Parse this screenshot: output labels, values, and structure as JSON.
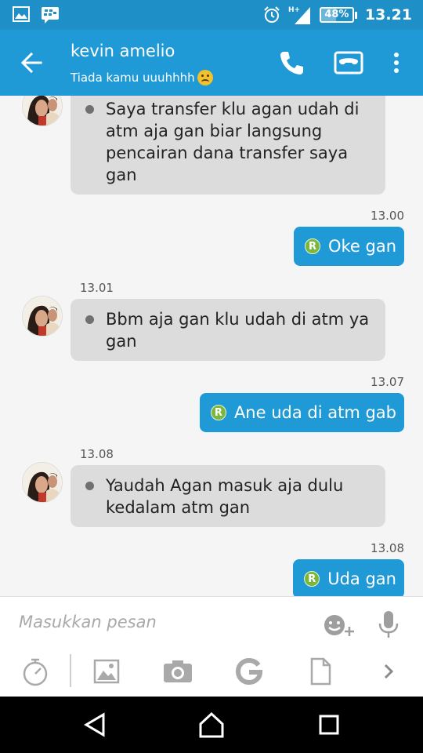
{
  "status_bar": {
    "time": "13.21",
    "battery_text": "48%",
    "battery_level": 0.48,
    "network": "H+",
    "icons": [
      "gallery-icon",
      "bbm-icon",
      "alarm-icon",
      "signal-icon",
      "battery-icon"
    ]
  },
  "header": {
    "contact_name": "kevin amelio",
    "contact_status": "Tiada kamu uuuhhhh",
    "status_emoji": "sad-face"
  },
  "messages": [
    {
      "direction": "incoming",
      "text_lines": [
        "Saya transfer klu agan udah di",
        "atm aja gan biar langsung",
        "pencairan dana transfer saya",
        "gan"
      ]
    },
    {
      "direction": "outgoing",
      "time": "13.00",
      "badge": "R",
      "text": "Oke gan"
    },
    {
      "direction": "incoming",
      "time": "13.01",
      "text_lines": [
        "Bbm aja gan klu udah di atm ya",
        "gan"
      ]
    },
    {
      "direction": "outgoing",
      "time": "13.07",
      "badge": "R",
      "text": "Ane uda di atm gab"
    },
    {
      "direction": "incoming",
      "time": "13.08",
      "text_lines": [
        "Yaudah Agan masuk aja dulu",
        "kedalam atm gan"
      ]
    },
    {
      "direction": "outgoing",
      "time": "13.08",
      "badge": "R",
      "text": "Uda gan"
    }
  ],
  "composer": {
    "placeholder": "Masukkan pesan"
  },
  "toolbar_icons": [
    "timer-icon",
    "gallery-icon",
    "camera-icon",
    "google-icon",
    "file-icon",
    "chevron-right-icon"
  ],
  "colors": {
    "app_bar": "#1f9ad6",
    "status_bar": "#1f8fc8",
    "incoming_bubble": "#dcdcdc",
    "outgoing_bubble": "#1f9ad6",
    "badge": "#7bb73c"
  }
}
